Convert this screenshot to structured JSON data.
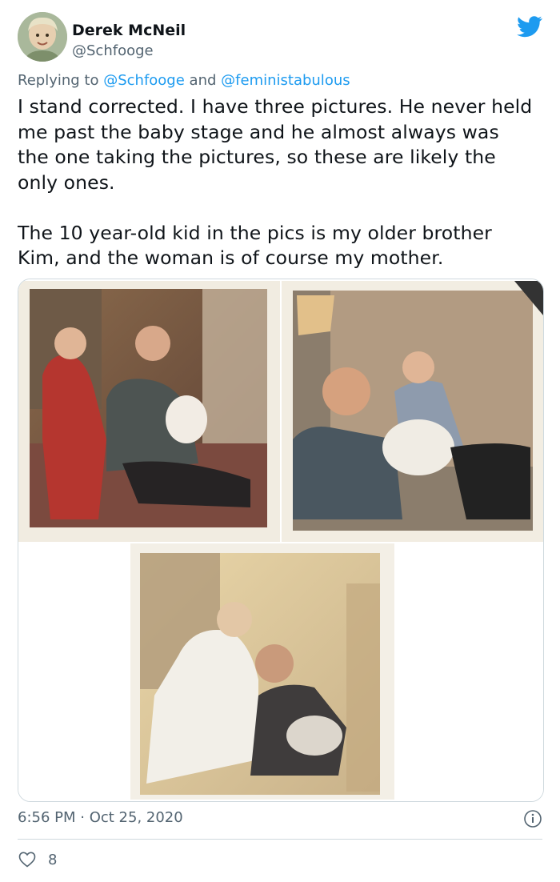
{
  "tweet": {
    "author_name": "Derek McNeil",
    "author_handle": "@Schfooge",
    "reply_prefix": "Replying to",
    "reply_user_1": "@Schfooge",
    "reply_and": "and",
    "reply_user_2": "@feministabulous",
    "body": "I stand corrected. I have three pictures. He never held\nme past the baby stage and he almost always was\nthe one taking the pictures, so these are likely the\nonly ones.\n\nThe 10 year-old kid in the pics is my older brother\nKim, and the woman is of course my mother.",
    "timestamp": "6:56 PM · Oct 25, 2020",
    "like_count": "8"
  },
  "colors": {
    "brand_blue": "#1d9bf0",
    "secondary_text": "#536471",
    "border": "#cfd9de"
  },
  "icons": {
    "bird": "twitter-bird-icon",
    "info": "info-icon",
    "like": "heart-icon"
  }
}
